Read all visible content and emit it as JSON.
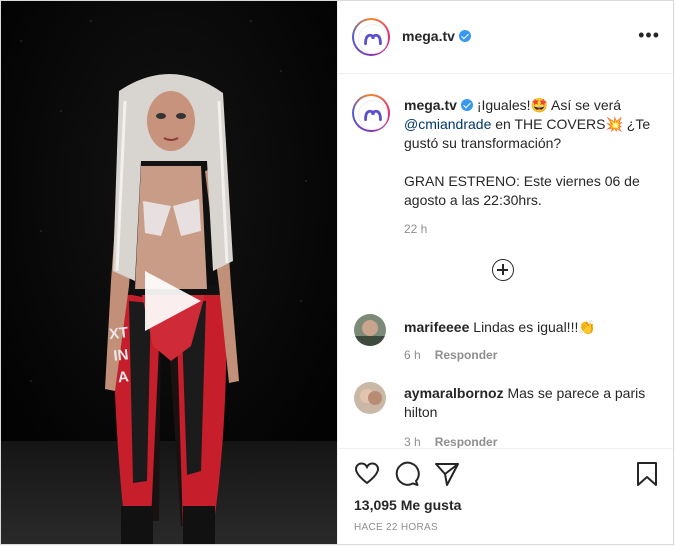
{
  "account": {
    "username": "mega.tv"
  },
  "header": {
    "more_label": "•••"
  },
  "caption": {
    "username": "mega.tv",
    "text_1": "¡Iguales!🤩 Así se verá ",
    "mention": "@cmiandrade",
    "text_2": " en THE COVERS💥 ¿Te gustó su transformación?",
    "text_3": "GRAN ESTRENO: Este viernes 06 de agosto a las 22:30hrs.",
    "time": "22 h"
  },
  "comments": [
    {
      "username": "marifeeee",
      "text": "Lindas es igual!!!👏",
      "time": "6 h",
      "reply_label": "Responder"
    },
    {
      "username": "aymaralbornoz",
      "text": "Mas se parece a paris hilton",
      "time": "3 h",
      "reply_label": "Responder"
    }
  ],
  "actions": {
    "likes": "13,095 Me gusta",
    "posted_ago": "HACE 22 HORAS"
  },
  "media": {
    "pants_text": "XTINA"
  },
  "icons": [
    "play-icon",
    "verified-icon",
    "more-icon",
    "plus-circle-icon",
    "heart-icon",
    "comment-icon",
    "share-icon",
    "bookmark-icon"
  ],
  "colors": {
    "verified": "#3897f0",
    "mention": "#00376b",
    "muted": "#8e8e8e"
  }
}
